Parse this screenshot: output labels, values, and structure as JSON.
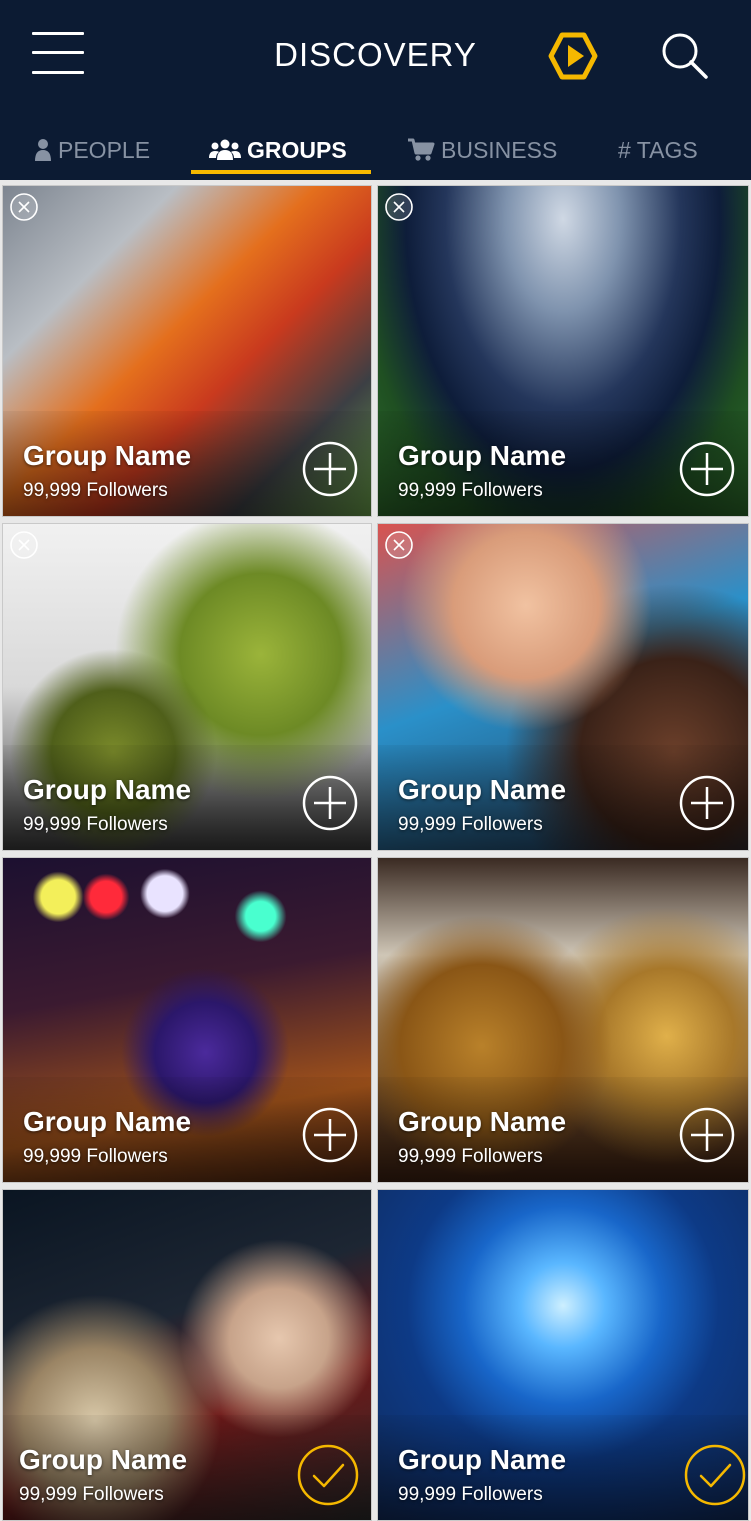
{
  "header": {
    "title": "DISCOVERY"
  },
  "tabs": [
    {
      "label": "PEOPLE",
      "icon": "person-icon",
      "active": false
    },
    {
      "label": "GROUPS",
      "icon": "group-icon",
      "active": true
    },
    {
      "label": "BUSINESS",
      "icon": "cart-icon",
      "active": false
    },
    {
      "label": "# TAGS",
      "icon": "",
      "active": false
    }
  ],
  "colors": {
    "header_bg": "#0c1b33",
    "accent": "#f5b800",
    "tab_inactive": "#8792a3",
    "text_light": "#ffffff"
  },
  "groups": [
    {
      "name": "Group Name",
      "followers": "99,999 Followers",
      "image": "motorcycle-racer-image",
      "action": "add",
      "removable": true
    },
    {
      "name": "Group Name",
      "followers": "99,999 Followers",
      "image": "stadium-image",
      "action": "add",
      "removable": true
    },
    {
      "name": "Group Name",
      "followers": "99,999 Followers",
      "image": "avocado-smoothie-image",
      "action": "add",
      "removable": true
    },
    {
      "name": "Group Name",
      "followers": "99,999 Followers",
      "image": "smiling-kids-image",
      "action": "add",
      "removable": true
    },
    {
      "name": "Group Name",
      "followers": "99,999 Followers",
      "image": "microphone-stage-image",
      "action": "add",
      "removable": false
    },
    {
      "name": "Group Name",
      "followers": "99,999 Followers",
      "image": "gavel-law-image",
      "action": "add",
      "removable": false
    },
    {
      "name": "Group Name",
      "followers": "99,999 Followers",
      "image": "3d-cinema-audience-image",
      "action": "joined",
      "removable": false
    },
    {
      "name": "Group Name",
      "followers": "99,999 Followers",
      "image": "digital-globe-image",
      "action": "joined",
      "removable": false
    }
  ]
}
